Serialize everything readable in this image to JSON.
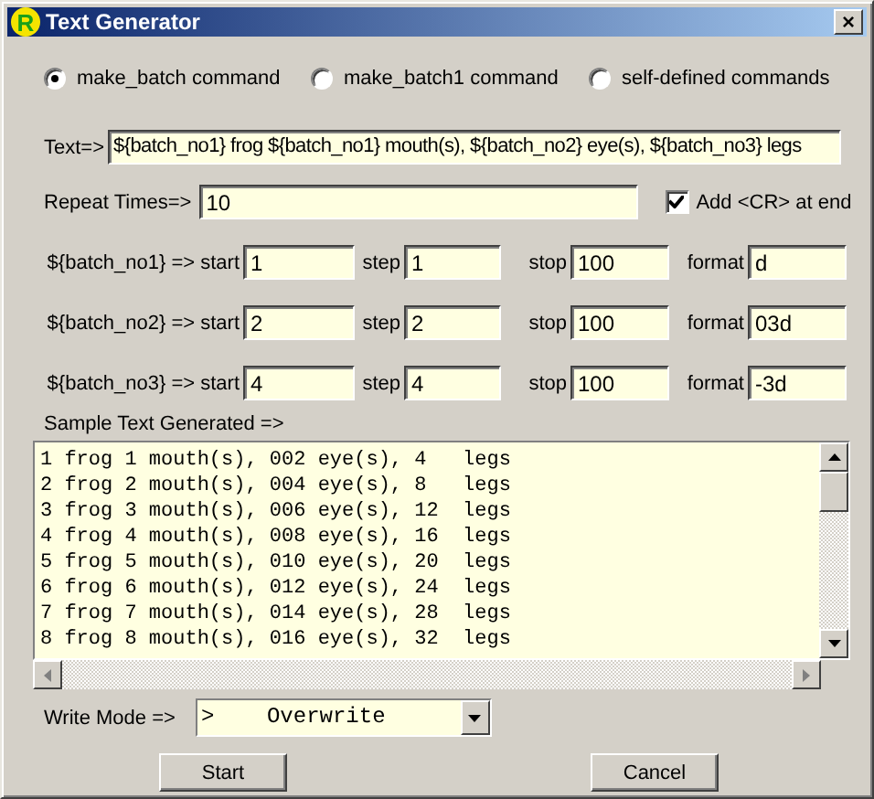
{
  "window": {
    "logo": "R",
    "title": "Text Generator",
    "close": "×"
  },
  "modes": [
    {
      "label": "make_batch command",
      "selected": true
    },
    {
      "label": "make_batch1 command",
      "selected": false
    },
    {
      "label": "self-defined commands",
      "selected": false
    }
  ],
  "text_field": {
    "label": "Text=>",
    "value": "${batch_no1} frog ${batch_no1} mouth(s), ${batch_no2} eye(s), ${batch_no3} legs"
  },
  "repeat": {
    "label": "Repeat Times=>",
    "value": "10"
  },
  "add_cr": {
    "label": "Add <CR> at end",
    "checked": true
  },
  "batches": [
    {
      "name": "${batch_no1} => start",
      "start": "1",
      "step_label": "step",
      "step": "1",
      "stop_label": "stop",
      "stop": "100",
      "format_label": "format",
      "format": "d"
    },
    {
      "name": "${batch_no2} => start",
      "start": "2",
      "step_label": "step",
      "step": "2",
      "stop_label": "stop",
      "stop": "100",
      "format_label": "format",
      "format": "03d"
    },
    {
      "name": "${batch_no3} => start",
      "start": "4",
      "step_label": "step",
      "step": "4",
      "stop_label": "stop",
      "stop": "100",
      "format_label": "format",
      "format": "-3d"
    }
  ],
  "sample": {
    "label": "Sample Text Generated =>",
    "lines": [
      "1 frog 1 mouth(s), 002 eye(s), 4   legs",
      "2 frog 2 mouth(s), 004 eye(s), 8   legs",
      "3 frog 3 mouth(s), 006 eye(s), 12  legs",
      "4 frog 4 mouth(s), 008 eye(s), 16  legs",
      "5 frog 5 mouth(s), 010 eye(s), 20  legs",
      "6 frog 6 mouth(s), 012 eye(s), 24  legs",
      "7 frog 7 mouth(s), 014 eye(s), 28  legs",
      "8 frog 8 mouth(s), 016 eye(s), 32  legs"
    ]
  },
  "write_mode": {
    "label": "Write Mode =>",
    "value": ">    Overwrite"
  },
  "buttons": [
    "Start",
    "Cancel"
  ]
}
